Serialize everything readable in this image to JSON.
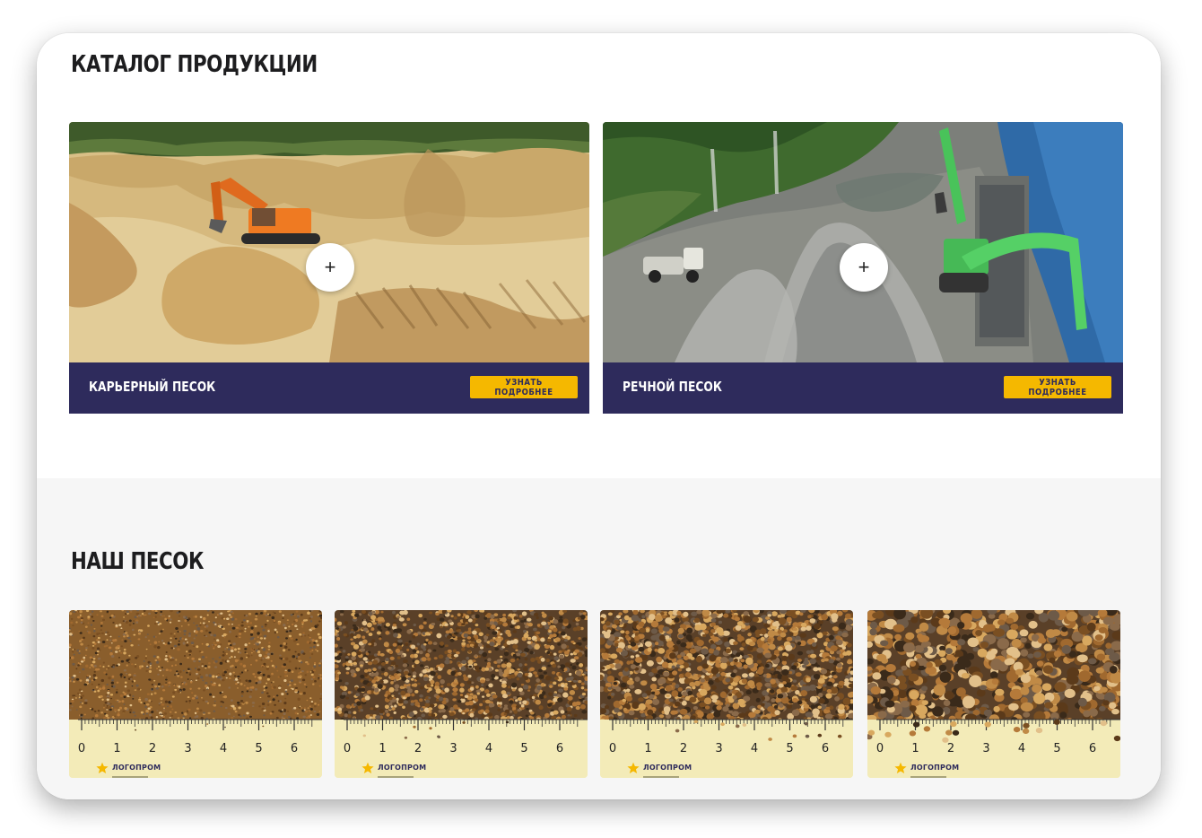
{
  "catalog": {
    "title": "КАТАЛОГ ПРОДУКЦИИ",
    "cards": [
      {
        "name": "КАРЬЕРНЫЙ ПЕСОК",
        "button": "УЗНАТЬ ПОДРОБНЕЕ",
        "plus": "+"
      },
      {
        "name": "РЕЧНОЙ ПЕСОК",
        "button": "УЗНАТЬ ПОДРОБНЕЕ",
        "plus": "+"
      }
    ]
  },
  "sand": {
    "title": "НАШ ПЕСОК",
    "ruler_labels": [
      "0",
      "1",
      "2",
      "3",
      "4",
      "5",
      "6"
    ],
    "brand": "ЛОГОПРОМ"
  },
  "colors": {
    "bar": "#2e2b5c",
    "button": "#f5b800"
  },
  "icons": [
    "plus-icon",
    "star-logo-icon"
  ]
}
